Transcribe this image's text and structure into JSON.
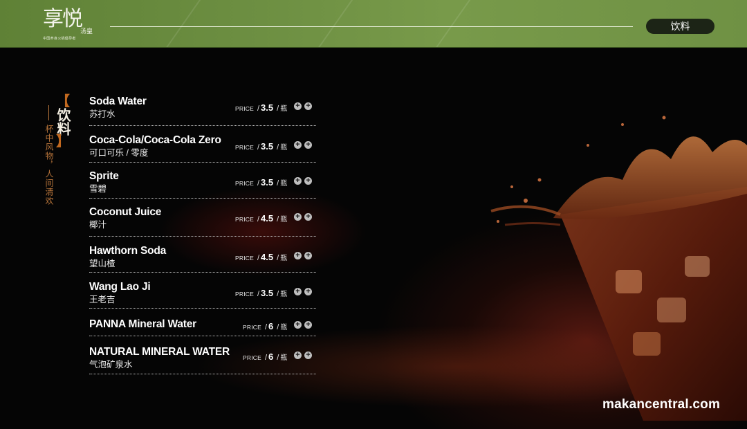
{
  "header": {
    "logo_mark": "享悦",
    "logo_sub": "汤皇",
    "logo_tag": "中国养身火锅倡导者",
    "section_pill": "饮料"
  },
  "side": {
    "title": "饮料",
    "bracket_open": "【",
    "bracket_close": "】",
    "slogan": "杯中风物，人间清欢"
  },
  "price_label": "PRICE",
  "unit": "瓶",
  "items": [
    {
      "en": "Soda Water",
      "cn": "苏打水",
      "price": "3.5"
    },
    {
      "en": "Coca-Cola/Coca-Cola Zero",
      "cn": "可口可乐 / 零度",
      "price": "3.5"
    },
    {
      "en": "Sprite",
      "cn": "雪碧",
      "price": "3.5"
    },
    {
      "en": "Coconut Juice",
      "cn": "椰汁",
      "price": "4.5"
    },
    {
      "en": "Hawthorn Soda",
      "cn": "望山楂",
      "price": "4.5"
    },
    {
      "en": "Wang Lao Ji",
      "cn": "王老吉",
      "price": "3.5"
    },
    {
      "en": "PANNA Mineral Water",
      "cn": "",
      "price": "6"
    },
    {
      "en": "NATURAL MINERAL WATER",
      "cn": "气泡矿泉水",
      "price": "6"
    }
  ],
  "watermark": "makancentral.com",
  "colors": {
    "header_green": "#6d8f42",
    "pill_bg": "#1c2416",
    "bracket": "#c2691f",
    "background": "#050505"
  },
  "icons": {
    "add": "plus-circle-icon"
  }
}
